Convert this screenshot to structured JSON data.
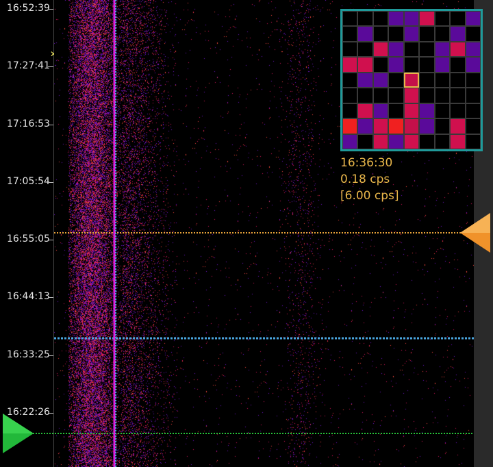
{
  "time_axis": {
    "labels": [
      "16:52:39",
      "17:27:41",
      "17:16:53",
      "17:05:54",
      "16:55:05",
      "16:44:13",
      "16:33:25",
      "16:22:26"
    ]
  },
  "info": {
    "time": "16:36:30",
    "rate": "0.18 cps",
    "peak_rate": "[6.00 cps]"
  },
  "colors": {
    "horizontal_cursor": "#e8a33a",
    "mid_cursor": "#4aa6e0",
    "bottom_cursor": "#27c23a",
    "vertical_cursor": "#e020e0",
    "minimap_border": "#1f9a9a",
    "selected_cell": "#e8b64a"
  },
  "mini_map": {
    "rows": 9,
    "cols": 9,
    "cells": [
      {
        "r": 0,
        "c": 3,
        "color": "#5a0a9a"
      },
      {
        "r": 0,
        "c": 4,
        "color": "#5a0a9a"
      },
      {
        "r": 0,
        "c": 5,
        "color": "#d0104e"
      },
      {
        "r": 0,
        "c": 8,
        "color": "#5a0a9a"
      },
      {
        "r": 1,
        "c": 1,
        "color": "#5a0a9a"
      },
      {
        "r": 1,
        "c": 4,
        "color": "#5a0a9a"
      },
      {
        "r": 1,
        "c": 7,
        "color": "#5a0a9a"
      },
      {
        "r": 2,
        "c": 2,
        "color": "#d0104e"
      },
      {
        "r": 2,
        "c": 3,
        "color": "#5a0a9a"
      },
      {
        "r": 2,
        "c": 6,
        "color": "#5a0a9a"
      },
      {
        "r": 2,
        "c": 7,
        "color": "#d0104e"
      },
      {
        "r": 2,
        "c": 8,
        "color": "#5a0a9a"
      },
      {
        "r": 3,
        "c": 0,
        "color": "#d0104e"
      },
      {
        "r": 3,
        "c": 1,
        "color": "#d0104e"
      },
      {
        "r": 3,
        "c": 3,
        "color": "#5a0a9a"
      },
      {
        "r": 3,
        "c": 6,
        "color": "#5a0a9a"
      },
      {
        "r": 3,
        "c": 8,
        "color": "#5a0a9a"
      },
      {
        "r": 4,
        "c": 1,
        "color": "#5a0a9a"
      },
      {
        "r": 4,
        "c": 2,
        "color": "#5a0a9a"
      },
      {
        "r": 4,
        "c": 4,
        "color": "#c4104a"
      },
      {
        "r": 5,
        "c": 4,
        "color": "#d0104e"
      },
      {
        "r": 6,
        "c": 1,
        "color": "#d0104e"
      },
      {
        "r": 6,
        "c": 2,
        "color": "#5a0a9a"
      },
      {
        "r": 6,
        "c": 4,
        "color": "#d0104e"
      },
      {
        "r": 6,
        "c": 5,
        "color": "#5a0a9a"
      },
      {
        "r": 7,
        "c": 0,
        "color": "#f02020"
      },
      {
        "r": 7,
        "c": 1,
        "color": "#5a0a9a"
      },
      {
        "r": 7,
        "c": 2,
        "color": "#d0104e"
      },
      {
        "r": 7,
        "c": 3,
        "color": "#f02020"
      },
      {
        "r": 7,
        "c": 4,
        "color": "#c4104a"
      },
      {
        "r": 7,
        "c": 5,
        "color": "#5a0a9a"
      },
      {
        "r": 7,
        "c": 7,
        "color": "#d0104e"
      },
      {
        "r": 8,
        "c": 0,
        "color": "#5a0a9a"
      },
      {
        "r": 8,
        "c": 2,
        "color": "#d0104e"
      },
      {
        "r": 8,
        "c": 3,
        "color": "#5a0a9a"
      },
      {
        "r": 8,
        "c": 4,
        "color": "#d0104e"
      },
      {
        "r": 8,
        "c": 7,
        "color": "#d0104e"
      }
    ],
    "selected": {
      "r": 4,
      "c": 4
    }
  }
}
